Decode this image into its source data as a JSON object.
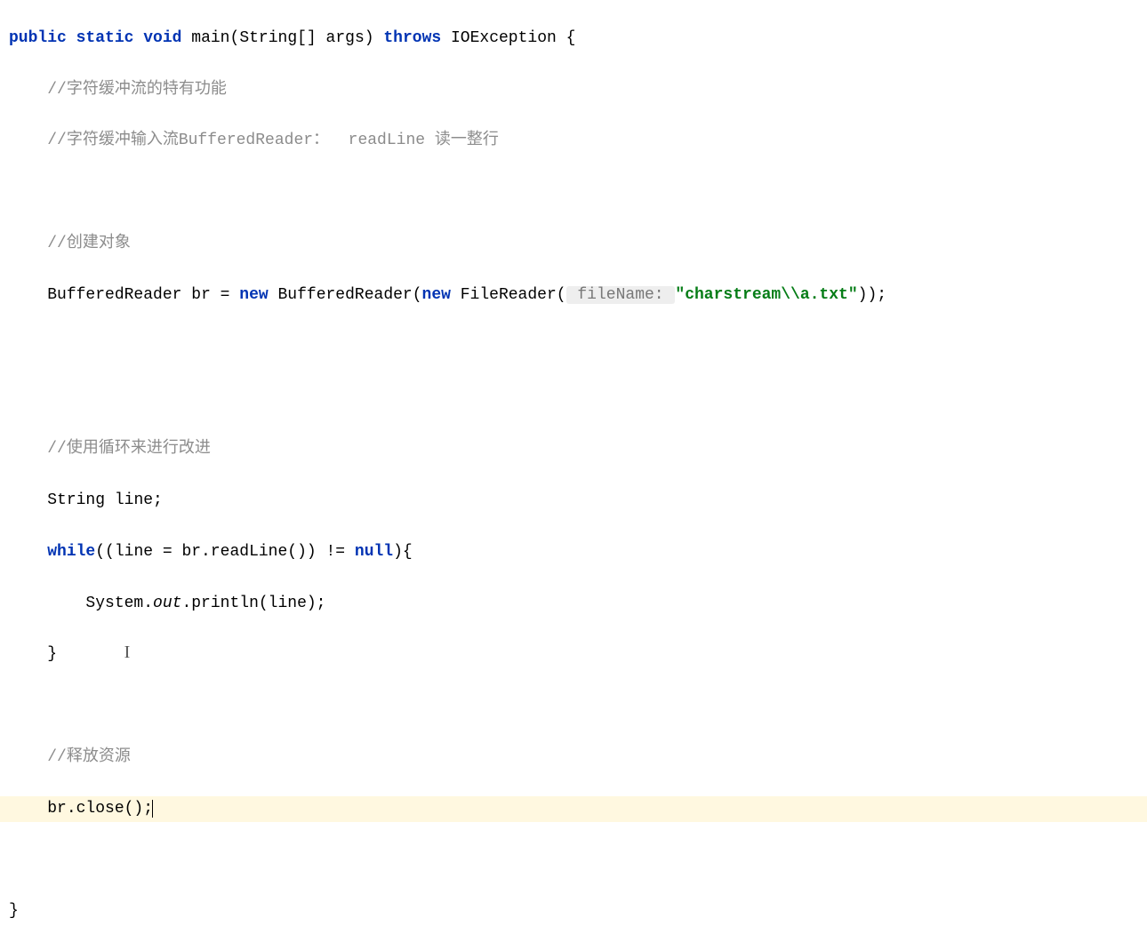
{
  "code": {
    "kw_public": "public",
    "kw_static": "static",
    "kw_void": "void",
    "method_name": "main",
    "param_type": "String[]",
    "param_name": "args",
    "kw_throws": "throws",
    "exception": "IOException",
    "brace_open": " {",
    "comment1": "//字符缓冲流的特有功能",
    "comment2": "//字符缓冲输入流BufferedReader：  readLine 读一整行",
    "comment3": "//创建对象",
    "type_br": "BufferedReader",
    "var_br": "br",
    "eq": " = ",
    "kw_new1": "new",
    "ctor_br": "BufferedReader(",
    "kw_new2": "new",
    "ctor_fr": "FileReader(",
    "hint_filename": " fileName: ",
    "str_filename": "\"charstream\\\\a.txt\"",
    "close_paren2": "));",
    "comment4": "//使用循环来进行改进",
    "type_string": "String",
    "var_line": "line;",
    "kw_while": "while",
    "while_cond_open": "((line = br.readLine()) != ",
    "kw_null": "null",
    "while_cond_close": "){",
    "sysout_prefix": "System.",
    "sysout_out": "out",
    "sysout_suffix": ".println(line);",
    "brace_close_while": "}",
    "comment5": "//释放资源",
    "stmt_close": "br.close();",
    "brace_close_method": "}"
  }
}
